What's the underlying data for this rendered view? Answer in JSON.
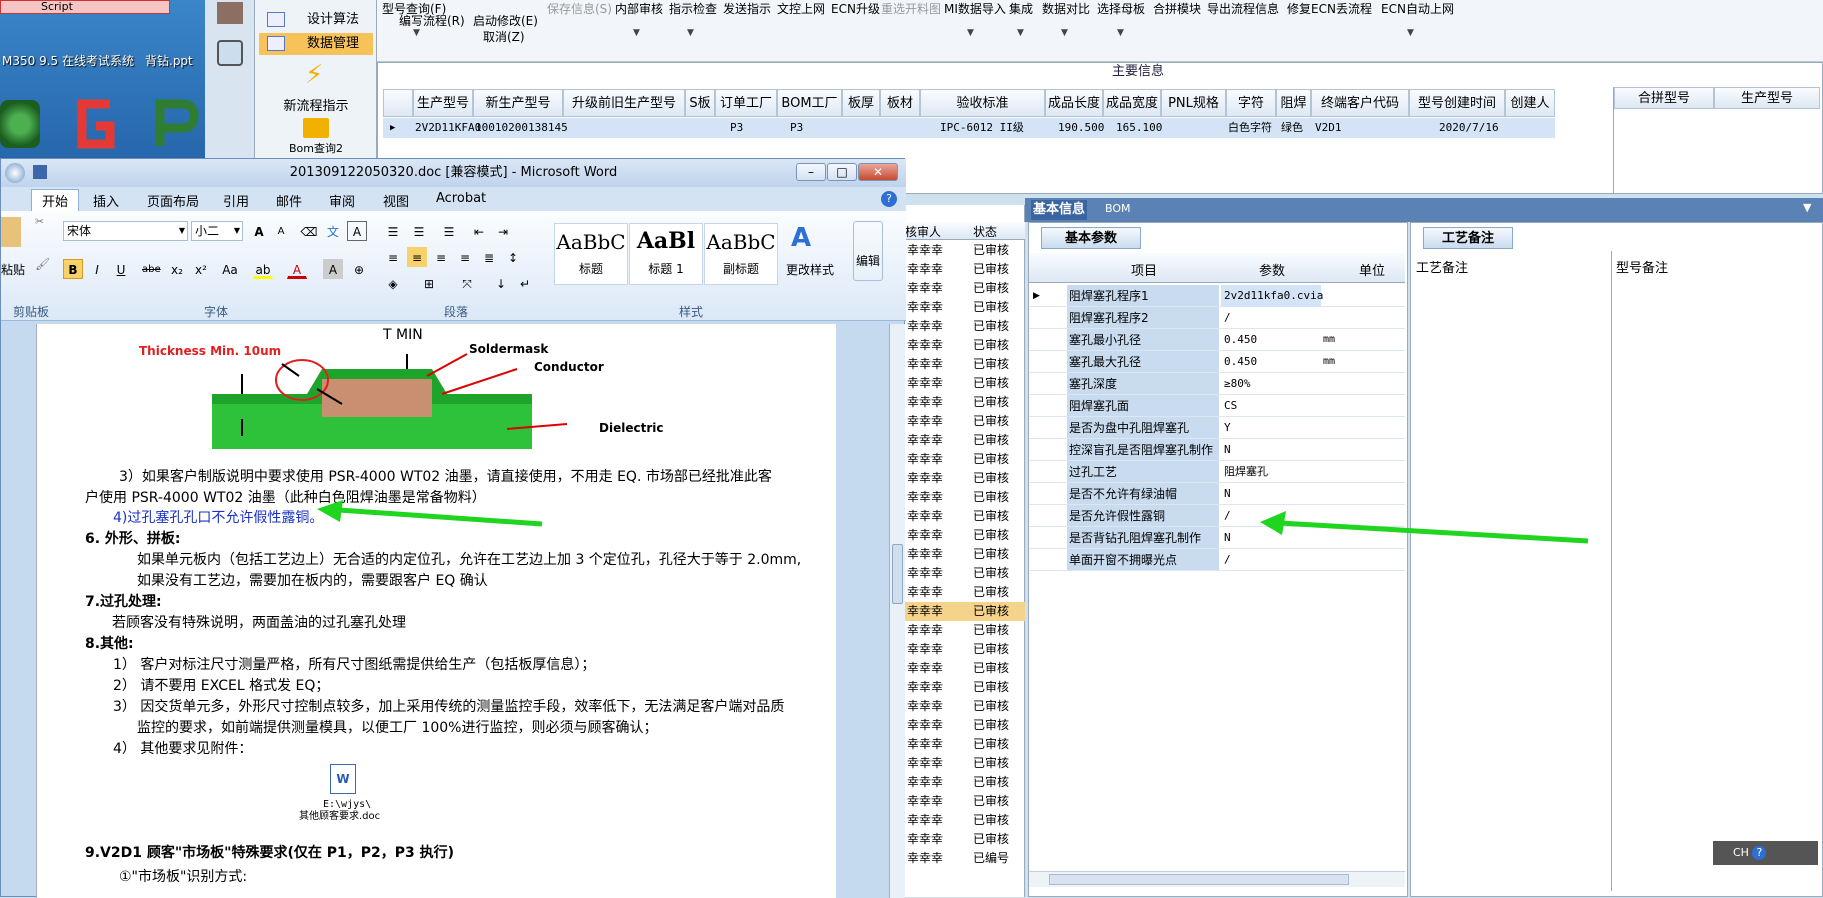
{
  "desktop": {
    "shortcut_label": "M350 9.5 在线考试系统",
    "file_label": "背钻.ppt",
    "notice_fragment": "Script"
  },
  "nav": {
    "items": [
      {
        "label": "设计算法"
      },
      {
        "label": "数据管理"
      }
    ],
    "big_items": [
      {
        "label": "新流程指示"
      },
      {
        "label": "Bom查询2"
      }
    ]
  },
  "toolbar": {
    "buttons": [
      {
        "label": "型号查询(F)",
        "disabled": false
      },
      {
        "label": "编写流程(R)",
        "disabled": false
      },
      {
        "label": "启动修改(E)",
        "sub": "取消(Z)",
        "disabled": false
      },
      {
        "label": "保存信息(S)",
        "disabled": true
      },
      {
        "label": "内部审核",
        "disabled": false
      },
      {
        "label": "指示检查",
        "disabled": false
      },
      {
        "label": "发送指示",
        "disabled": false
      },
      {
        "label": "文控上网",
        "disabled": false
      },
      {
        "label": "ECN升级",
        "disabled": false
      },
      {
        "label": "重选开料图",
        "disabled": true
      },
      {
        "label": "MI数据导入",
        "disabled": false
      },
      {
        "label": "集成",
        "disabled": false
      },
      {
        "label": "数据对比",
        "disabled": false
      },
      {
        "label": "选择母板",
        "disabled": false
      },
      {
        "label": "合拼模块",
        "disabled": false
      },
      {
        "label": "导出流程信息",
        "disabled": false
      },
      {
        "label": "修复ECN丢流程",
        "disabled": false
      },
      {
        "label": "ECN自动上网",
        "disabled": false
      }
    ]
  },
  "main": {
    "title": "主要信息",
    "columns": [
      "生产型号",
      "新生产型号",
      "升级前旧生产型号",
      "S板",
      "订单工厂",
      "BOM工厂",
      "板厚",
      "板材",
      "验收标准",
      "成品长度",
      "成品宽度",
      "PNL规格",
      "字符",
      "阻焊",
      "终端客户代码",
      "型号创建时间",
      "创建人"
    ],
    "row": [
      "2V2D11KFA0",
      "10010200138145",
      "",
      "",
      "P3",
      "P3",
      "",
      "",
      "IPC-6012 II级",
      "190.500",
      "165.100",
      "",
      "白色字符",
      "绿色",
      "V2D1",
      "2020/7/16",
      ""
    ],
    "side_columns": [
      "合拼型号",
      "生产型号"
    ]
  },
  "word": {
    "title": "201309122050320.doc [兼容模式] - Microsoft Word",
    "tabs": [
      "开始",
      "插入",
      "页面布局",
      "引用",
      "邮件",
      "审阅",
      "视图",
      "Acrobat"
    ],
    "font_name": "宋体",
    "font_size": "小二",
    "groups": [
      "剪贴板",
      "字体",
      "段落",
      "样式"
    ],
    "styles": [
      {
        "preview": "AaBbC",
        "name": "标题"
      },
      {
        "preview": "AaBl",
        "name": "标题 1"
      },
      {
        "preview": "AaBbC",
        "name": "副标题"
      }
    ],
    "change_style": "更改样式",
    "edit": "编辑",
    "paste": "粘贴",
    "figure": {
      "t_min": "T MIN",
      "thickness": "Thickness Min. 10um",
      "soldermask": "Soldermask",
      "conductor": "Conductor",
      "dielectric": "Dielectric"
    },
    "lines": [
      "3）如果客户制版说明中要求使用 PSR-4000 WT02 油墨，请直接使用，不用走 EQ. 市场部已经批准此客",
      "户使用 PSR-4000 WT02 油墨（此种白色阻焊油墨是常备物料）",
      "4)过孔塞孔孔口不允许假性露铜。",
      "6.  外形、拼板:",
      "如果单元板内（包括工艺边上）无合适的内定位孔，允许在工艺边上加 3 个定位孔，孔径大于等于 2.0mm,",
      "如果没有工艺边，需要加在板内的，需要跟客户 EQ 确认",
      "7.过孔处理:",
      "若顾客没有特殊说明，两面盖油的过孔塞孔处理",
      "8.其他:",
      "1）  客户对标注尺寸测量严格，所有尺寸图纸需提供给生产（包括板厚信息）；",
      "2）  请不要用 EXCEL 格式发 EQ；",
      "3）  因交货单元多，外形尺寸控制点较多，加上采用传统的测量监控手段，效率低下，无法满足客户端对品质",
      "监控的要求，如前端提供测量模具，以便工厂 100%进行监控，则必须与顾客确认；",
      "4）  其他要求见附件：",
      "E:\\wjys\\",
      "其他顾客要求.doc",
      "9.V2D1 顾客\"市场板\"特殊要求(仅在 P1，P2，P3 执行)",
      "①\"市场板\"识别方式:"
    ]
  },
  "midlist": {
    "headers": [
      "核审人",
      "状态"
    ],
    "reviewer": "幸幸幸",
    "status": "已审核",
    "last_status": "已编号"
  },
  "right": {
    "tabs": [
      "基本信息",
      "BOM"
    ],
    "subtab": "基本参数",
    "columns": [
      "项目",
      "参数",
      "单位"
    ],
    "rows": [
      {
        "item": "阻焊塞孔程序1",
        "value": "2v2d11kfa0.cvia",
        "unit": ""
      },
      {
        "item": "阻焊塞孔程序2",
        "value": "/",
        "unit": ""
      },
      {
        "item": "塞孔最小孔径",
        "value": "0.450",
        "unit": "mm"
      },
      {
        "item": "塞孔最大孔径",
        "value": "0.450",
        "unit": "mm"
      },
      {
        "item": "塞孔深度",
        "value": "≥80%",
        "unit": ""
      },
      {
        "item": "阻焊塞孔面",
        "value": "CS",
        "unit": ""
      },
      {
        "item": "是否为盘中孔阻焊塞孔",
        "value": "Y",
        "unit": ""
      },
      {
        "item": "控深盲孔是否阻焊塞孔制作",
        "value": "N",
        "unit": ""
      },
      {
        "item": "过孔工艺",
        "value": "阻焊塞孔",
        "unit": ""
      },
      {
        "item": "是否不允许有绿油帽",
        "value": "N",
        "unit": ""
      },
      {
        "item": "是否允许假性露铜",
        "value": "/",
        "unit": ""
      },
      {
        "item": "是否背钻孔阻焊塞孔制作",
        "value": "N",
        "unit": ""
      },
      {
        "item": "单面开窗不拥曝光点",
        "value": "/",
        "unit": ""
      }
    ],
    "note_tab": "工艺备注",
    "note_columns": [
      "工艺备注",
      "型号备注"
    ],
    "ime": "CH"
  }
}
